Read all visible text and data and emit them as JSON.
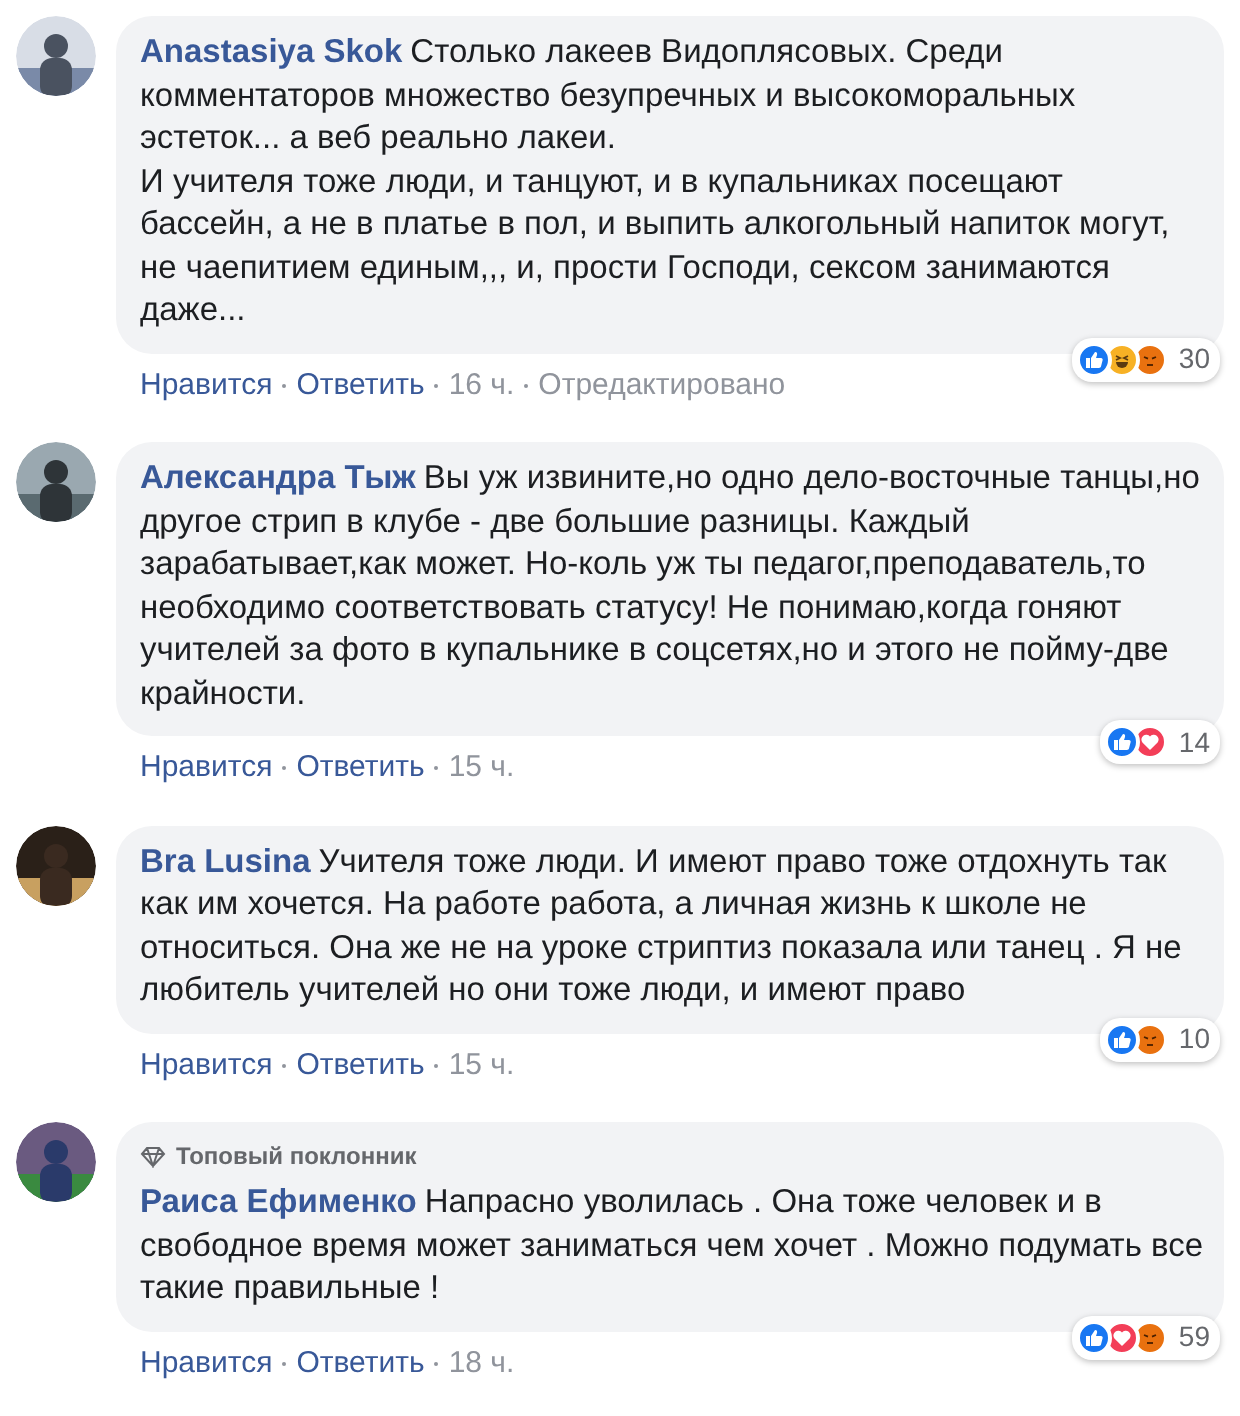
{
  "comments": [
    {
      "author": "Anastasiya Skok",
      "text": "Столько лакеев Видоплясовых. Среди комментаторов множество безупречных и высокоморальных эстеток... а веб реально лакеи.\nИ учителя тоже люди, и танцуют, и в купальниках посещают бассейн, а не в платье в пол, и выпить алкогольный напиток могут, не чаепитием единым,,, и, прости Господи, сексом занимаются даже...",
      "actions": [
        "Нравится",
        "Ответить"
      ],
      "time": "16 ч.",
      "edited": "Отредактировано",
      "reactions": [
        {
          "kind": "like"
        },
        {
          "kind": "haha"
        },
        {
          "kind": "angry"
        }
      ],
      "count": "30"
    },
    {
      "author": "Александра Тыж",
      "text": "Вы уж извините,но одно дело-восточные танцы,но другое стрип в клубе - две большие разницы. Каждый зарабатывает,как может. Но-коль уж ты педагог,преподаватель,то необходимо соответствовать статусу! Не понимаю,когда гоняют учителей за фото в купальнике в соцсетях,но и этого не пойму-две крайности.",
      "actions": [
        "Нравится",
        "Ответить"
      ],
      "time": "15 ч.",
      "reactions": [
        {
          "kind": "like"
        },
        {
          "kind": "love"
        }
      ],
      "count": "14"
    },
    {
      "author": "Bra Lusina",
      "text": "Учителя тоже люди. И имеют право тоже отдохнуть так как им хочется. На работе работа, а личная жизнь к школе не относиться. Она же не на уроке стриптиз показала или танец . Я не любитель учителей но они тоже люди, и имеют право",
      "actions": [
        "Нравится",
        "Ответить"
      ],
      "time": "15 ч.",
      "reactions": [
        {
          "kind": "like"
        },
        {
          "kind": "angry"
        }
      ],
      "count": "10"
    },
    {
      "badge": "Топовый поклонник",
      "author": "Раиса Ефименко",
      "text": "Напрасно уволилась . Она тоже человек и в свободное время может заниматься чем хочет . Можно подумать все такие правильные !",
      "actions": [
        "Нравится",
        "Ответить"
      ],
      "time": "18 ч.",
      "reactions": [
        {
          "kind": "like"
        },
        {
          "kind": "love"
        },
        {
          "kind": "angry"
        }
      ],
      "count": "59"
    }
  ]
}
